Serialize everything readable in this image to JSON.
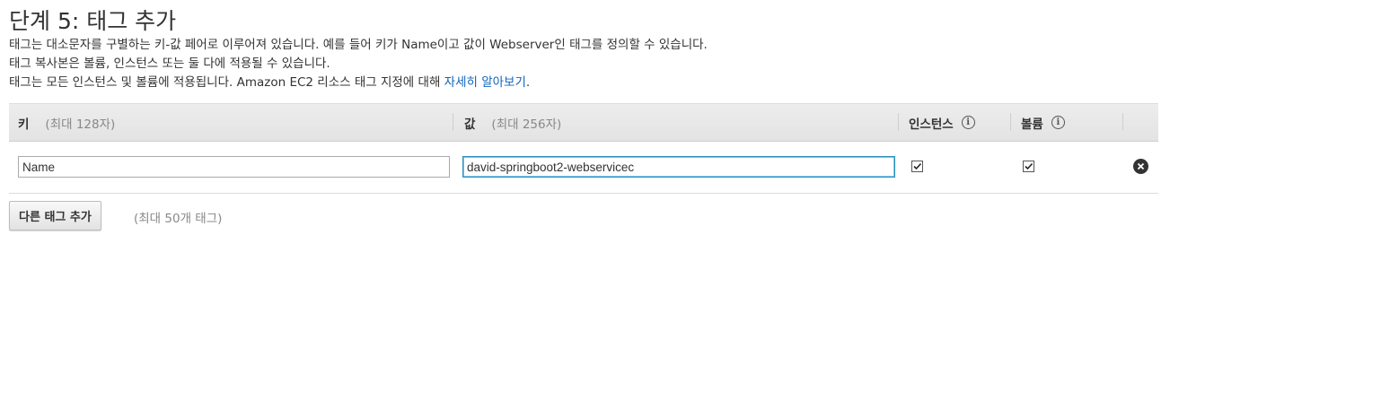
{
  "page": {
    "title": "단계 5: 태그 추가",
    "description": {
      "line1": "태그는 대소문자를 구별하는 키-값 페어로 이루어져 있습니다. 예를 들어 키가 Name이고 값이 Webserver인 태그를 정의할 수 있습니다.",
      "line2": "태그 복사본은 볼륨, 인스턴스 또는 둘 다에 적용될 수 있습니다.",
      "line3_prefix": "태그는 모든 인스턴스 및 볼륨에 적용됩니다. Amazon EC2 리소스 태그 지정에 대해 ",
      "line3_link": "자세히 알아보기",
      "line3_suffix": "."
    }
  },
  "table": {
    "headers": {
      "key_label": "키",
      "key_hint": "(최대 128자)",
      "value_label": "값",
      "value_hint": "(최대 256자)",
      "instances_label": "인스턴스",
      "volumes_label": "볼륨"
    },
    "rows": [
      {
        "key": "Name",
        "value": "david-springboot2-webservicec",
        "instances_checked": true,
        "volumes_checked": true
      }
    ]
  },
  "footer": {
    "add_button_label": "다른 태그 추가",
    "limit_hint": "(최대 50개 태그)"
  },
  "colors": {
    "link": "#1166bb",
    "header_bg": "#e8e8e8",
    "focus_border": "#2a8fbd"
  },
  "icons": {
    "info": "info-circle-icon",
    "remove": "remove-circle-x-icon",
    "check": "checkmark-icon"
  }
}
